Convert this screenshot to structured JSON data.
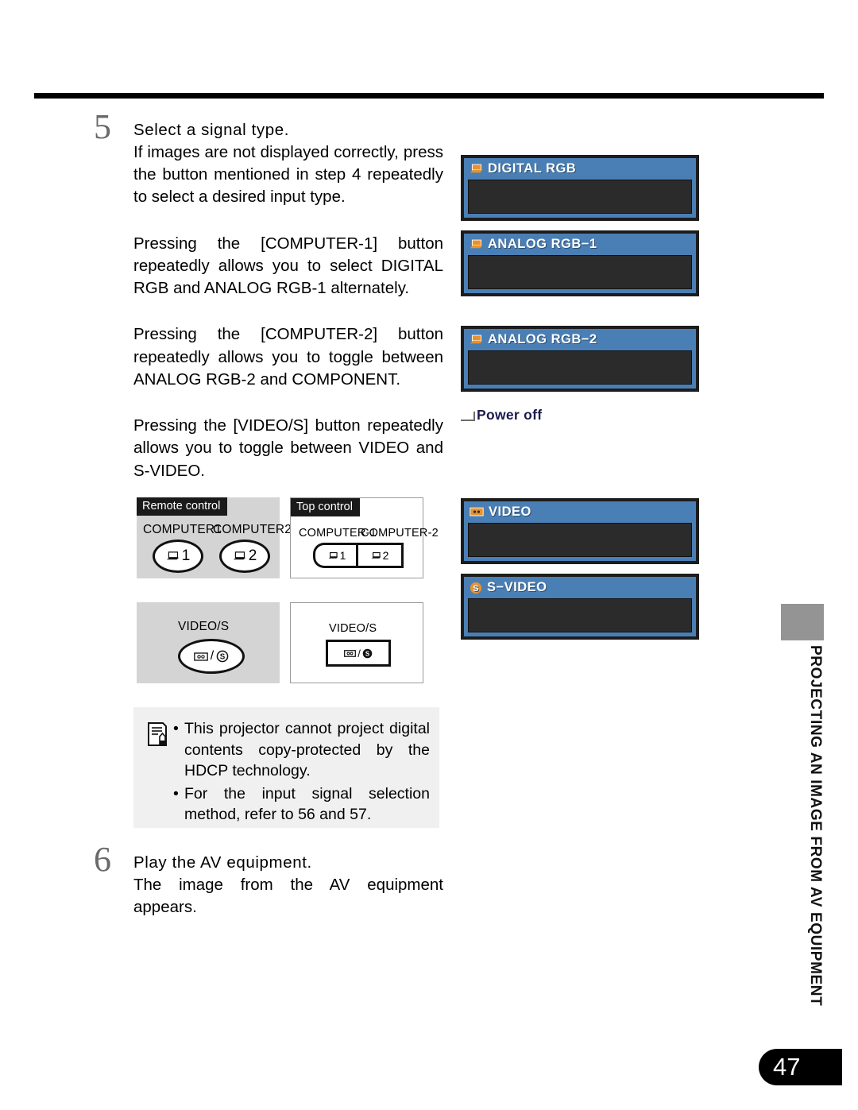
{
  "page": {
    "number": "47",
    "side_title": "PROJECTING AN IMAGE FROM AV EQUIPMENT"
  },
  "steps": [
    {
      "number": "5",
      "title": "Select a signal type.",
      "paragraphs": [
        "If images are not displayed correctly, press the button mentioned in step 4 repeatedly to select a desired input type.",
        "Pressing the [COMPUTER-1] button repeatedly allows you to select DIGITAL RGB and ANALOG RGB-1 alternately.",
        "Pressing the [COMPUTER-2] button repeatedly allows you to toggle between ANALOG RGB-2 and COMPONENT.",
        "Pressing the [VIDEO/S] button repeatedly allows you to toggle between VIDEO and S-VIDEO."
      ]
    },
    {
      "number": "6",
      "title": "Play the AV equipment.",
      "paragraphs": [
        "The image from the AV equipment appears."
      ]
    }
  ],
  "diagrams": {
    "remote_control": {
      "label": "Remote control",
      "computer1_caption": "COMPUTER1",
      "computer2_caption": "COMPUTER2",
      "computer1_digit": "1",
      "computer2_digit": "2",
      "video_caption": "VIDEO/S",
      "video_separator": "/"
    },
    "top_control": {
      "label": "Top control",
      "computer1_caption": "COMPUTER-1",
      "computer2_caption": "COMPUTER-2",
      "computer1_digit": "1",
      "computer2_digit": "2",
      "video_caption": "VIDEO/S",
      "video_separator": "/"
    }
  },
  "note": {
    "items": [
      "This projector cannot project digital contents copy-protected by the HDCP technology.",
      "For the input signal selection method, refer to 56 and 57."
    ],
    "bullet": "•"
  },
  "osd_panels": [
    {
      "title": "DIGITAL RGB",
      "icon": "laptop-icon"
    },
    {
      "title": "ANALOG RGB−1",
      "icon": "laptop-icon"
    },
    {
      "title": "ANALOG RGB−2",
      "icon": "laptop-icon"
    },
    {
      "title": "VIDEO",
      "icon": "tape-icon"
    },
    {
      "title": "S−VIDEO",
      "icon": "s-video-icon"
    }
  ],
  "power_off": {
    "label": "Power off"
  },
  "colors": {
    "osd_blue": "#4a7fb5",
    "osd_screen": "#2b2b2b",
    "osd_border": "#1c1c1c",
    "icon_orange": "#e8922e",
    "note_bg": "#f0f0f0",
    "diagram_gray": "#d4d4d4",
    "side_tab_gray": "#949494",
    "power_off_text": "#1b1b4f"
  }
}
